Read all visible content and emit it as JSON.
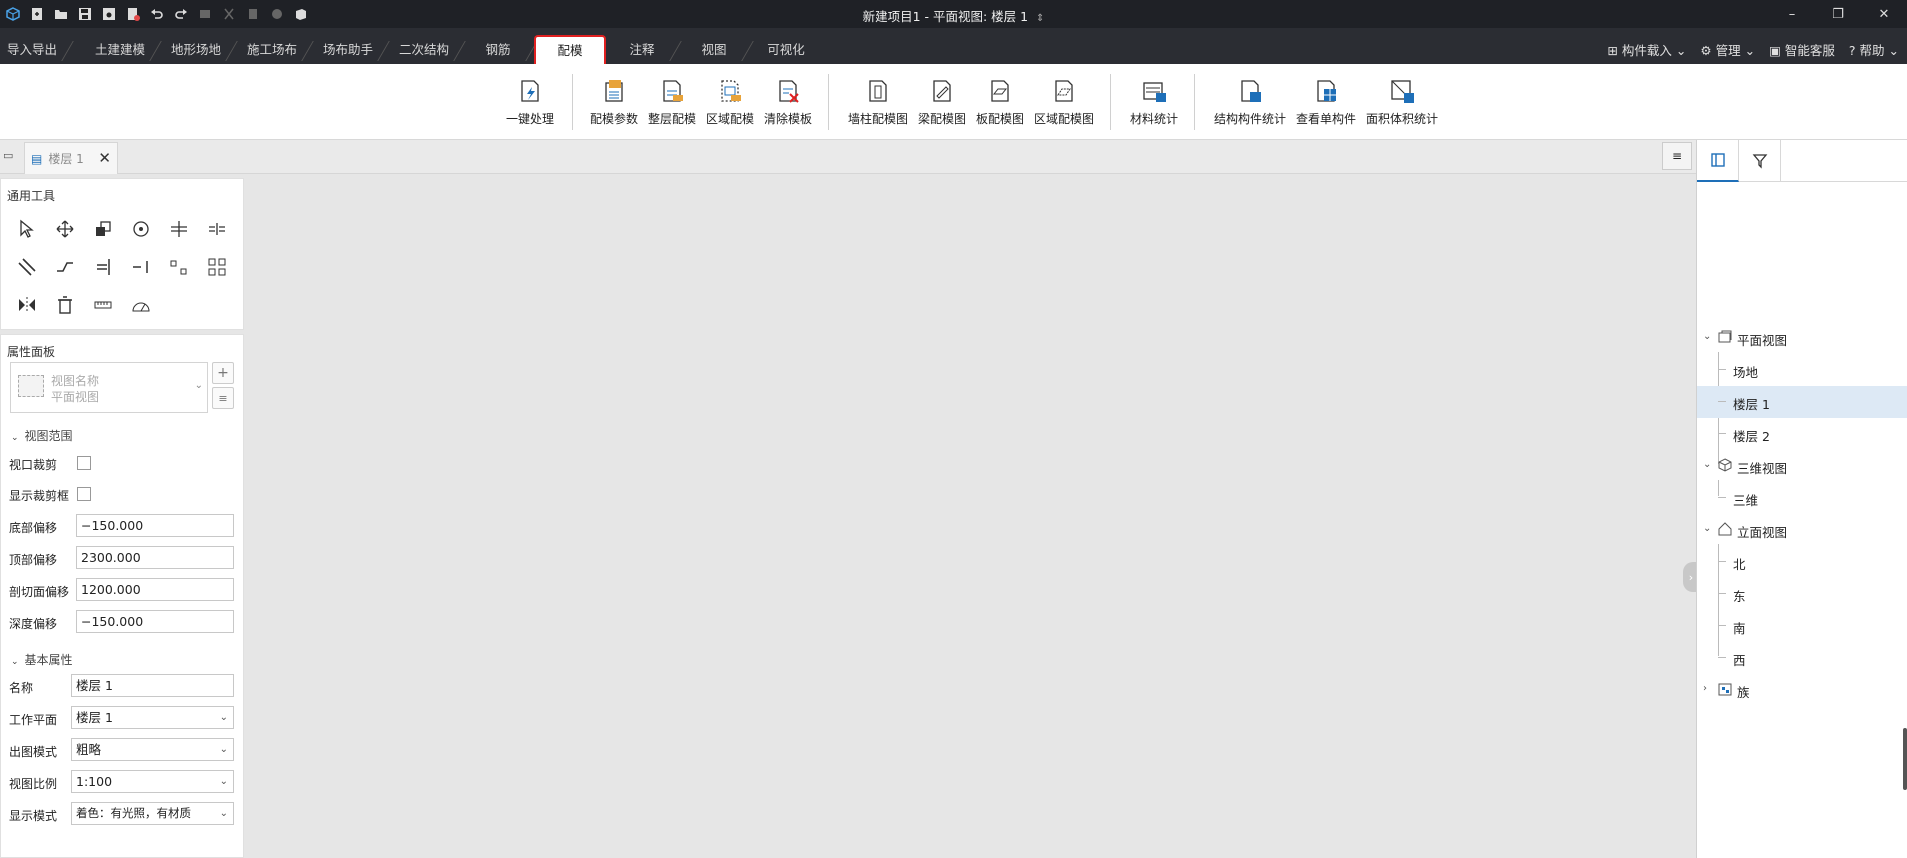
{
  "window": {
    "title": "新建项目1 - 平面视图: 楼层 1",
    "title_suffix": "⇕",
    "controls": [
      "–",
      "❐",
      "✕"
    ]
  },
  "quick_access": [
    "app-logo-icon",
    "new-file-icon",
    "open-folder-icon",
    "save-icon",
    "save-as-icon",
    "export-icon",
    "undo-icon",
    "redo-icon",
    "select-box-icon",
    "cut-icon",
    "copy-icon",
    "paste-icon",
    "view3d-icon"
  ],
  "tabs": [
    "导入导出",
    "土建建模",
    "地形场地",
    "施工场布",
    "场布助手",
    "二次结构",
    "钢筋",
    "配模",
    "注释",
    "视图",
    "可视化"
  ],
  "active_tab": "配模",
  "tab_right": {
    "import_component": "构件载入",
    "manage": "管理",
    "support": "智能客服",
    "help": "帮助"
  },
  "ribbon": {
    "auto_process": "一键处理",
    "formwork_params": "配模参数",
    "floor_formwork": "整层配模",
    "area_formwork": "区域配模",
    "clear_formwork": "清除模板",
    "wall_column_drawing": "墙柱配模图",
    "beam_drawing": "梁配模图",
    "slab_drawing": "板配模图",
    "area_drawing": "区域配模图",
    "material_stats": "材料统计",
    "component_stats": "结构构件统计",
    "view_single": "查看单构件",
    "area_volume_stats": "面积体积统计"
  },
  "doc_tab": {
    "label": "楼层 1",
    "close": "✕",
    "menu": "≡"
  },
  "tools": {
    "title": "通用工具"
  },
  "properties": {
    "title": "属性面板",
    "view_name_label": "视图名称",
    "view_name_value": "平面视图",
    "add": "+",
    "list": "≡",
    "group_view_range": "视图范围",
    "viewport_crop": "视口裁剪",
    "show_crop_box": "显示裁剪框",
    "bottom_offset_label": "底部偏移",
    "bottom_offset": "−150.000",
    "top_offset_label": "顶部偏移",
    "top_offset": "2300.000",
    "cut_offset_label": "剖切面偏移",
    "cut_offset": "1200.000",
    "depth_offset_label": "深度偏移",
    "depth_offset": "−150.000",
    "group_basic": "基本属性",
    "name_label": "名称",
    "name": "楼层 1",
    "workplane_label": "工作平面",
    "workplane": "楼层 1",
    "output_mode_label": "出图模式",
    "output_mode": "粗略",
    "scale_label": "视图比例",
    "scale": "1:100",
    "display_mode_label": "显示模式",
    "display_mode": "着色：有光照，有材质"
  },
  "tree": {
    "plan_views": "平面视图",
    "site": "场地",
    "floor1": "楼层 1",
    "floor2": "楼层 2",
    "views3d": "三维视图",
    "view3d": "三维",
    "elevations": "立面视图",
    "north": "北",
    "east": "东",
    "south": "南",
    "west": "西",
    "families": "族"
  },
  "colors": {
    "titlebar": "#1f2126",
    "tabbar": "#2b2d33",
    "active_border": "#e02020",
    "selected_row": "#dde9f5",
    "accent_blue": "#1e6fb8"
  }
}
